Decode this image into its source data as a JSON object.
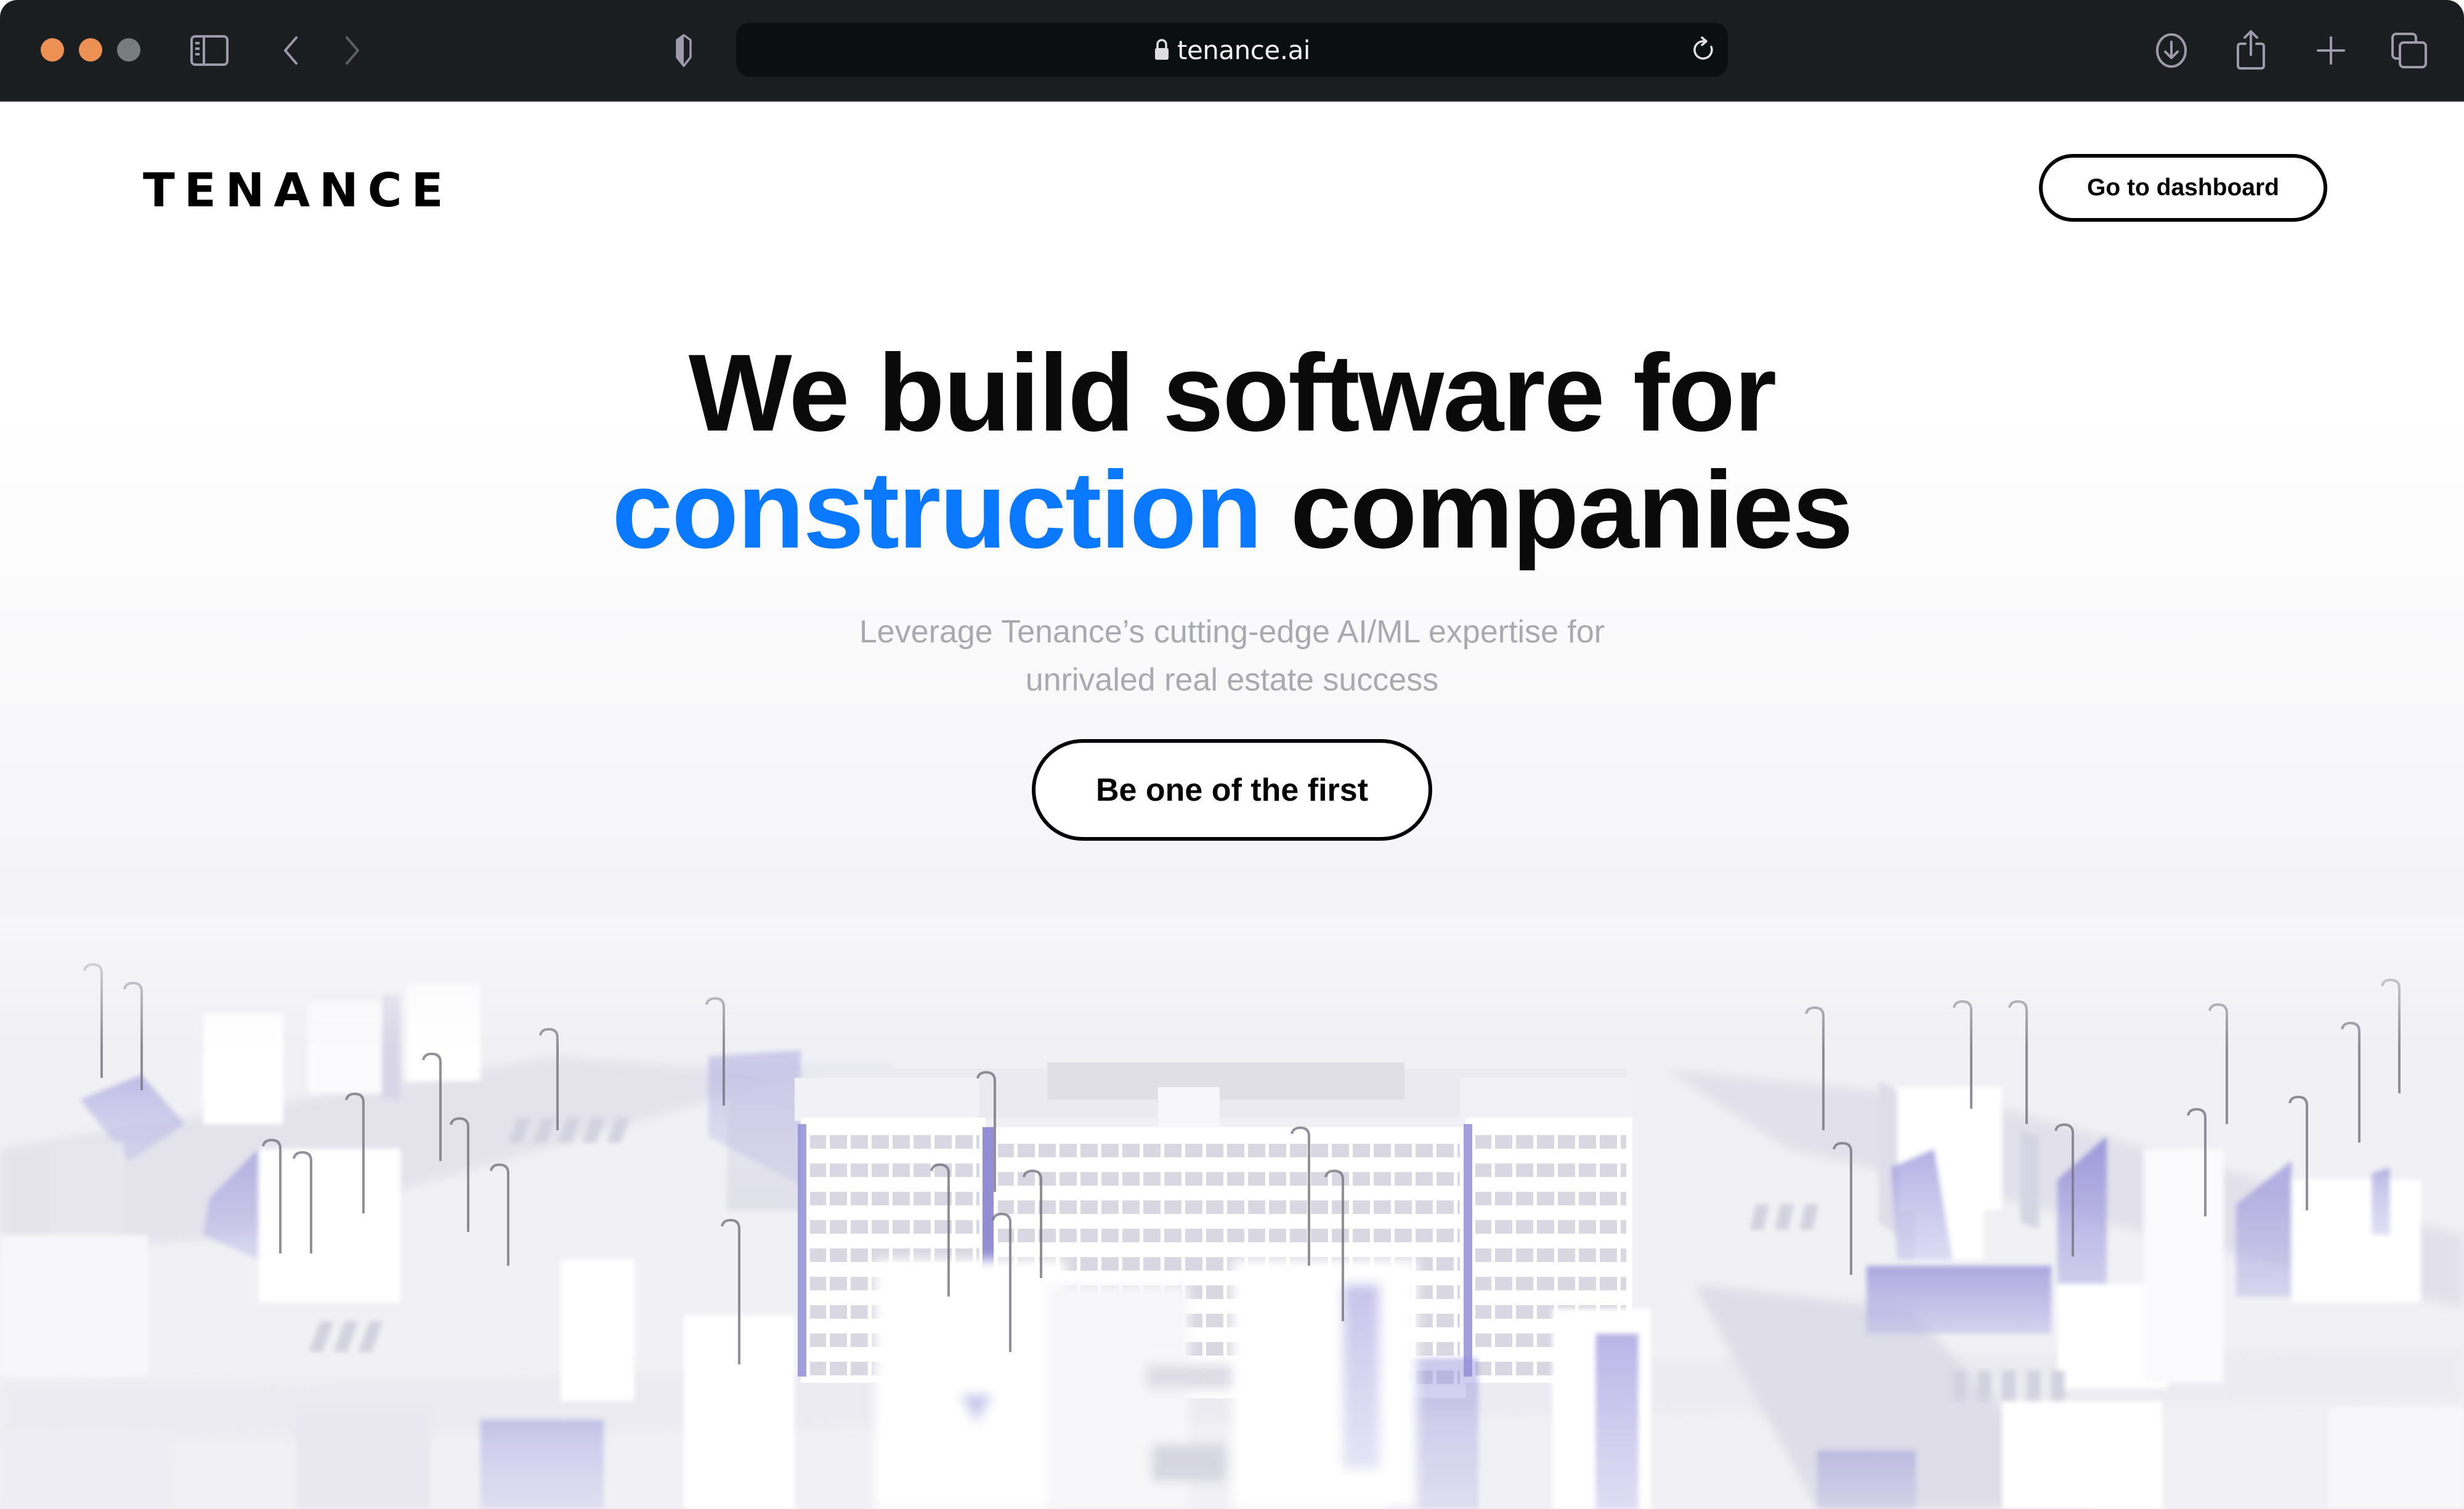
{
  "browser": {
    "url": "tenance.ai",
    "icons": {
      "traffic_lights": [
        "close",
        "minimize",
        "maximize"
      ],
      "sidebar": "sidebar-icon",
      "back": "chevron-left-icon",
      "forward": "chevron-right-icon",
      "privacy": "shield-icon",
      "lock": "lock-icon",
      "reload": "reload-icon",
      "download": "download-icon",
      "share": "share-icon",
      "new_tab": "plus-icon",
      "tabs": "tabs-overview-icon"
    },
    "colors": {
      "chrome_bg": "#1b1e21",
      "urlbar_bg": "#0c0f12",
      "close": "#ec9153",
      "minimize": "#ec9153",
      "maximize": "#777c7f",
      "icon": "#9e9aab"
    }
  },
  "header": {
    "logo": "TENANCE",
    "dashboard_button": "Go to dashboard"
  },
  "hero": {
    "title_line1": "We build software for",
    "title_accent": "construction",
    "title_rest": "companies",
    "subtitle_line1": "Leverage Tenance’s cutting-edge AI/ML expertise for",
    "subtitle_line2": "unrivaled real estate success",
    "cta": "Be one of the first"
  },
  "illustration": {
    "description": "3D isometric white city model with purple shadows, central curved apartment building and street lamps"
  },
  "colors": {
    "accent": "#0a78ff",
    "text": "#0a0a0a",
    "muted": "#a9a9b0",
    "shadow_purple": "#8a86d6"
  }
}
